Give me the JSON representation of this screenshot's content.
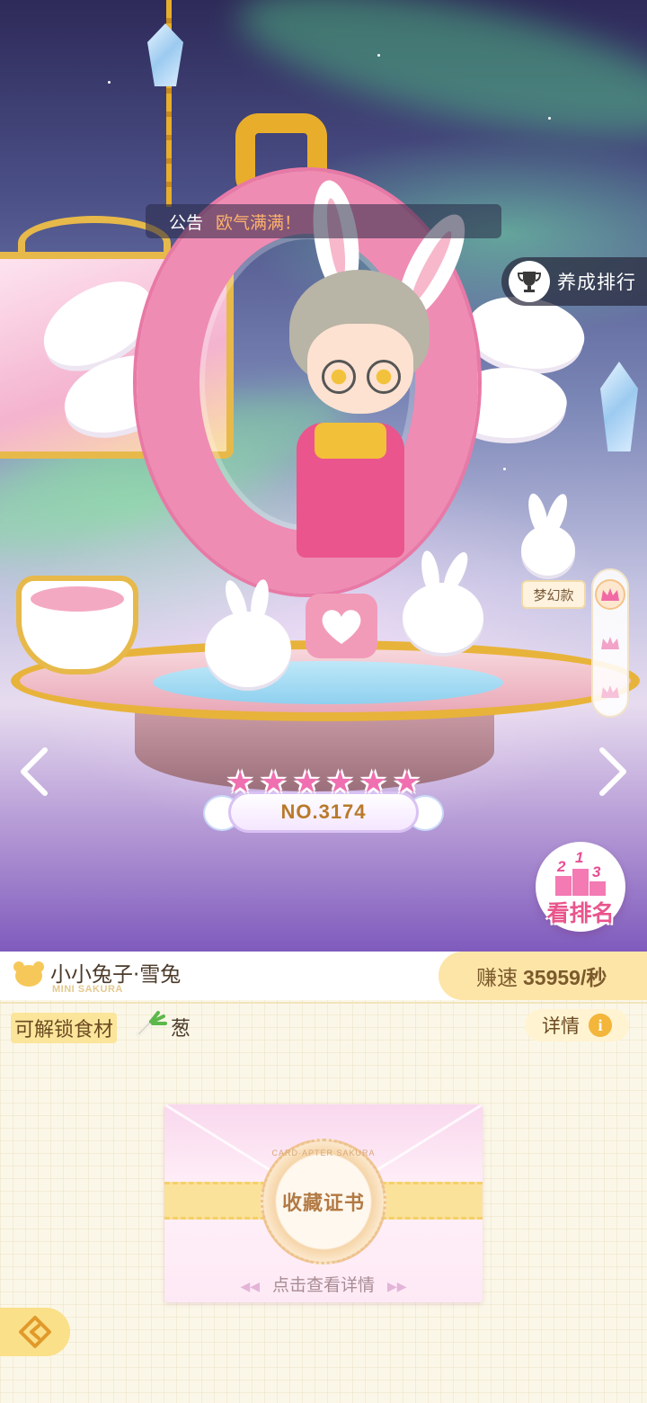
{
  "notice": {
    "label": "公告",
    "text": "欧气满满！"
  },
  "ranking_button": {
    "label": "养成排行",
    "icon": "trophy-icon"
  },
  "style_tag": {
    "label": "梦幻款"
  },
  "style_switch": {
    "options": [
      "crown-icon-1",
      "crown-icon-2",
      "crown-icon-3"
    ],
    "selected_index": 0
  },
  "navigation": {
    "prev_icon": "chevron-left-icon",
    "next_icon": "chevron-right-icon"
  },
  "badge": {
    "number": "NO.3174",
    "stars": 6
  },
  "leaderboard_button": {
    "label": "看排名",
    "podium": [
      "2",
      "1",
      "3"
    ]
  },
  "item": {
    "name": "小小兔子·雪兔",
    "subtitle": "MINI SAKURA",
    "speed_label": "赚速",
    "speed_value": "35959/秒"
  },
  "ingredient": {
    "tag": "可解锁食材",
    "name": "葱",
    "detail_label": "详情"
  },
  "certificate": {
    "ring_text": "CARD·APTER SAKURA",
    "title": "收藏证书",
    "hint": "点击查看详情"
  },
  "colors": {
    "accent_pink": "#e9558c",
    "gold": "#e8ae2b",
    "panel_bg": "#fbf7e8"
  }
}
